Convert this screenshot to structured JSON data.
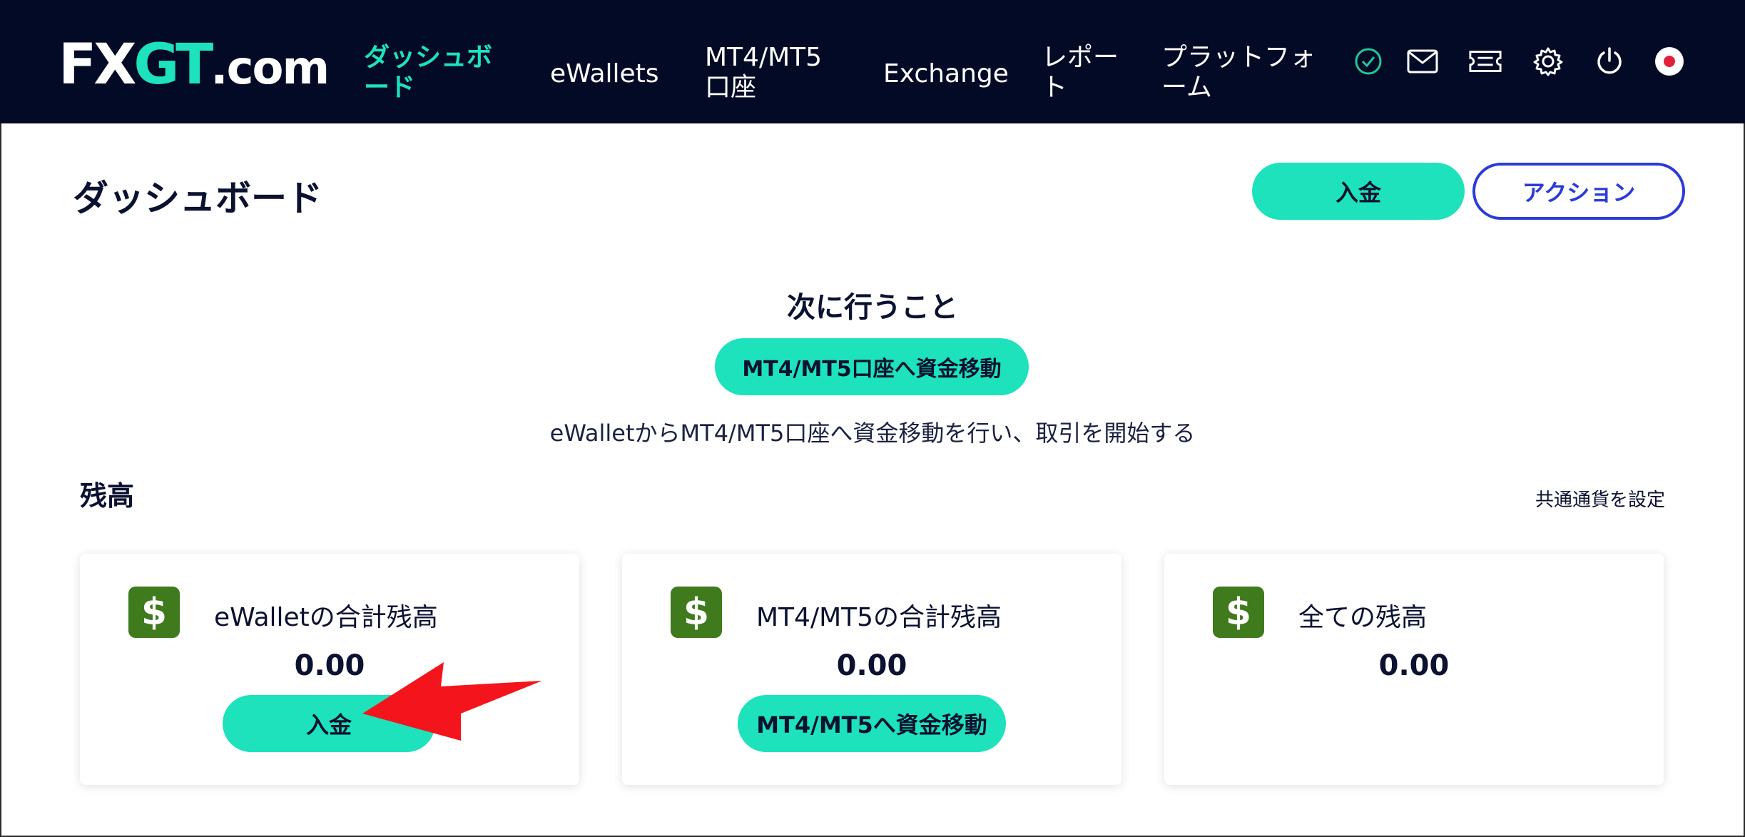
{
  "brand": {
    "logo_fx": "FX",
    "logo_gt": "GT",
    "logo_com": ".com"
  },
  "nav": {
    "dashboard_l1": "ダッシュボ",
    "dashboard_l2": "ード",
    "ewallets": "eWallets",
    "mt_l1": "MT4/MT5",
    "mt_l2": "口座",
    "exchange": "Exchange",
    "report_l1": "レポー",
    "report_l2": "ト",
    "platform_l1": "プラットフォ",
    "platform_l2": "ーム",
    "icons": [
      "check-circle-icon",
      "mail-icon",
      "ticket-icon",
      "gear-icon",
      "power-icon",
      "flag-japan-icon"
    ]
  },
  "page": {
    "title": "ダッシュボード",
    "deposit_button": "入金",
    "action_button": "アクション"
  },
  "next_steps": {
    "title": "次に行うこと",
    "button": "MT4/MT5口座へ資金移動",
    "description": "eWalletからMT4/MT5口座へ資金移動を行い、取引を開始する"
  },
  "balance": {
    "title": "残高",
    "set_currency_link": "共通通貨を設定",
    "cards": [
      {
        "label": "eWalletの合計残高",
        "amount": "0.00",
        "button": "入金"
      },
      {
        "label": "MT4/MT5の合計残高",
        "amount": "0.00",
        "button": "MT4/MT5へ資金移動"
      },
      {
        "label": "全ての残高",
        "amount": "0.00"
      }
    ]
  },
  "colors": {
    "navbar": "#030a26",
    "accent": "#1de2bb",
    "outline_blue": "#2b3bd9",
    "dollar_green": "#3f7a1d",
    "arrow_red": "#f4141b"
  }
}
